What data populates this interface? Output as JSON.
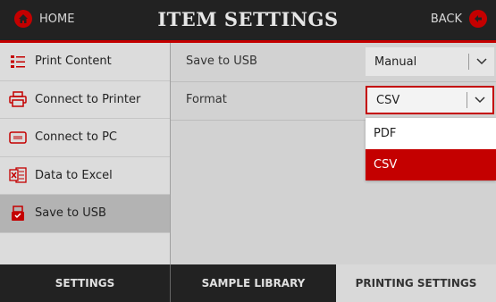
{
  "header": {
    "home_label": "HOME",
    "title": "ITEM SETTINGS",
    "back_label": "BACK",
    "accent_color": "#c40000"
  },
  "sidebar": {
    "items": [
      {
        "label": "Print Content",
        "icon": "list-icon"
      },
      {
        "label": "Connect to Printer",
        "icon": "printer-icon"
      },
      {
        "label": "Connect to PC",
        "icon": "pc-icon"
      },
      {
        "label": "Data to Excel",
        "icon": "excel-icon"
      },
      {
        "label": "Save to USB",
        "icon": "usb-save-icon",
        "active": true
      }
    ]
  },
  "settings": {
    "save_to_usb": {
      "label": "Save to USB",
      "value": "Manual"
    },
    "format": {
      "label": "Format",
      "value": "CSV",
      "options": [
        "PDF",
        "CSV"
      ]
    }
  },
  "footer": {
    "tabs": [
      "SETTINGS",
      "SAMPLE LIBRARY",
      "PRINTING SETTINGS"
    ],
    "active_tab": "PRINTING SETTINGS"
  }
}
